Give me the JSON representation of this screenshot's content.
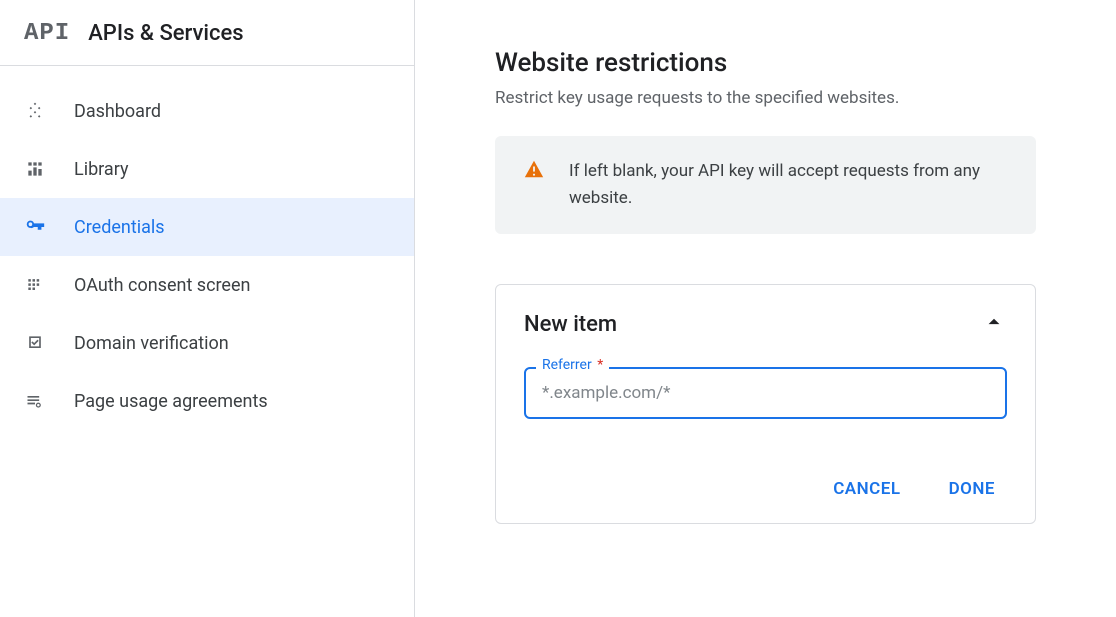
{
  "sidebar": {
    "title": "APIs & Services",
    "items": [
      {
        "label": "Dashboard"
      },
      {
        "label": "Library"
      },
      {
        "label": "Credentials"
      },
      {
        "label": "OAuth consent screen"
      },
      {
        "label": "Domain verification"
      },
      {
        "label": "Page usage agreements"
      }
    ]
  },
  "main": {
    "title": "Website restrictions",
    "description": "Restrict key usage requests to the specified websites.",
    "warning_text": "If left blank, your API key will accept requests from any website."
  },
  "card": {
    "title": "New item",
    "field_label": "Referrer",
    "required_mark": "*",
    "placeholder": "*.example.com/*",
    "value": "",
    "cancel_label": "CANCEL",
    "done_label": "DONE"
  }
}
